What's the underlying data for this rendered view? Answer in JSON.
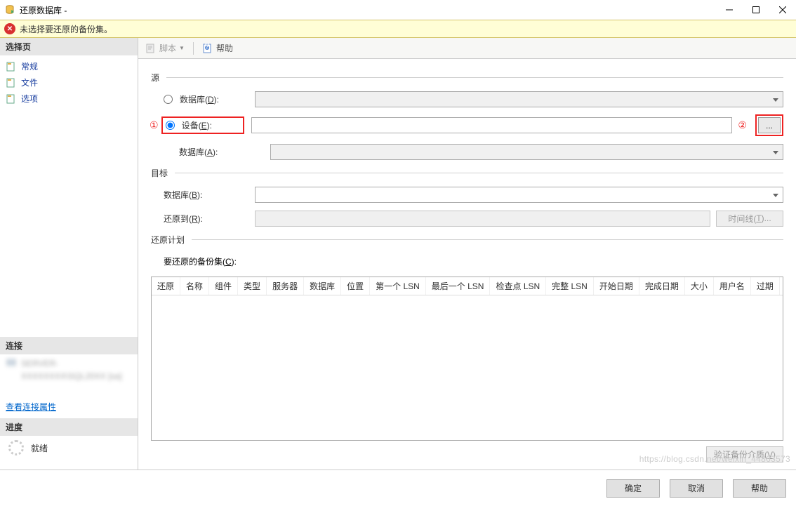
{
  "window": {
    "title": "还原数据库 -"
  },
  "warning": {
    "text": "未选择要还原的备份集。"
  },
  "sidebar": {
    "select_header": "选择页",
    "pages": [
      {
        "label": "常规"
      },
      {
        "label": "文件"
      },
      {
        "label": "选项"
      }
    ],
    "connection_header": "连接",
    "connection_text": "SERVER-XXXXXXXX\\SQL20XX [sa]",
    "view_props_link": "查看连接属性",
    "progress_header": "进度",
    "progress_status": "就绪"
  },
  "toolbar": {
    "script_label": "脚本",
    "help_label": "帮助"
  },
  "annotations": {
    "one": "①",
    "two": "②"
  },
  "source": {
    "legend": "源",
    "db_radio_prefix": "数据库(",
    "db_radio_u": "D",
    "device_radio_prefix": "设备(",
    "device_radio_u": "E",
    "db_label_prefix": "数据库(",
    "db_label_u": "A",
    "suffix": "):",
    "browse_label": "..."
  },
  "target": {
    "legend": "目标",
    "db_prefix": "数据库(",
    "db_u": "B",
    "restore_to_prefix": "还原到(",
    "restore_to_u": "R",
    "suffix": "):",
    "timeline_prefix": "时间线(",
    "timeline_u": "T",
    "timeline_suffix": ")..."
  },
  "plan": {
    "legend": "还原计划",
    "backupsets_prefix": "要还原的备份集(",
    "backupsets_u": "C",
    "suffix": "):",
    "columns": [
      "还原",
      "名称",
      "组件",
      "类型",
      "服务器",
      "数据库",
      "位置",
      "第一个 LSN",
      "最后一个 LSN",
      "检查点 LSN",
      "完整 LSN",
      "开始日期",
      "完成日期",
      "大小",
      "用户名",
      "过期"
    ],
    "verify_prefix": "验证备份介质(",
    "verify_u": "V",
    "verify_suffix": ")"
  },
  "footer": {
    "ok": "确定",
    "cancel": "取消",
    "help": "帮助"
  },
  "watermark": "https://blog.csdn.net/weixin_44863573"
}
